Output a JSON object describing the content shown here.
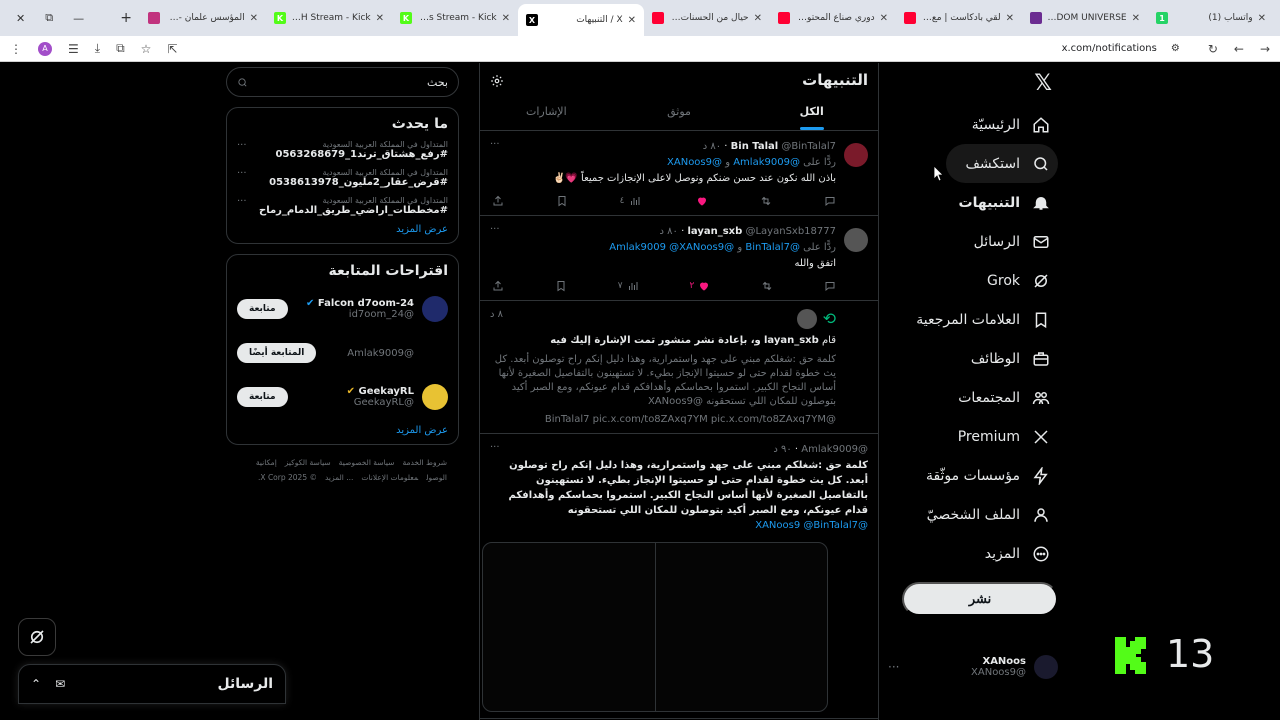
{
  "browser": {
    "tabs": [
      {
        "title": "واتساب (1)",
        "fav_color": "#25d366",
        "fav_text": "1"
      },
      {
        "title": "STARDOM UNIVERSE",
        "fav_color": "#6b2c91",
        "fav_text": ""
      },
      {
        "title": "لقي بادكاست | مع أبو...",
        "fav_color": "#ff0033",
        "fav_text": ""
      },
      {
        "title": "دوري صناع المحتوى -",
        "fav_color": "#ff0033",
        "fav_text": ""
      },
      {
        "title": "حيال من الحسنات يحدث...",
        "fav_color": "#ff0033",
        "fav_text": ""
      },
      {
        "title": "X / التنبيهات",
        "fav_color": "#000000",
        "fav_text": "X"
      },
      {
        "title": "XANoos Stream - Kick",
        "fav_color": "#53fc18",
        "fav_text": "K"
      },
      {
        "title": "OSAMAH Stream - Kick",
        "fav_color": "#53fc18",
        "fav_text": "K"
      },
      {
        "title": "المؤسس علمان -Play",
        "fav_color": "#c1337e",
        "fav_text": ""
      }
    ],
    "active_tab_index": 5,
    "url": "x.com/notifications",
    "profile_initial": "A"
  },
  "nav": {
    "items": [
      {
        "label": "الرئيسيّة",
        "icon": "home-icon",
        "key": "home"
      },
      {
        "label": "استكشف",
        "icon": "search-icon",
        "key": "explore"
      },
      {
        "label": "التنبيهات",
        "icon": "bell-icon",
        "key": "notifications"
      },
      {
        "label": "الرسائل",
        "icon": "mail-icon",
        "key": "messages"
      },
      {
        "label": "Grok",
        "icon": "grok-icon",
        "key": "grok"
      },
      {
        "label": "العلامات المرجعية",
        "icon": "bookmark-icon",
        "key": "bookmarks"
      },
      {
        "label": "الوظائف",
        "icon": "briefcase-icon",
        "key": "jobs"
      },
      {
        "label": "المجتمعات",
        "icon": "people-icon",
        "key": "communities"
      },
      {
        "label": "Premium",
        "icon": "x-logo-icon",
        "key": "premium"
      },
      {
        "label": "مؤسسات موثّقة",
        "icon": "lightning-icon",
        "key": "orgs"
      },
      {
        "label": "الملف الشخصيّ",
        "icon": "user-icon",
        "key": "profile"
      },
      {
        "label": "المزيد",
        "icon": "more-circle-icon",
        "key": "more"
      }
    ],
    "post_label": "نشر",
    "account": {
      "name": "XANoos",
      "handle": "@XANoos9"
    }
  },
  "center": {
    "title": "التنبيهات",
    "tabs": [
      "الكل",
      "موثق",
      "الإشارات"
    ],
    "notifications": [
      {
        "name": "Bin Talal",
        "handle": "@BinTalal7",
        "time": "٨٠ د",
        "reply_prefix": "ردًّا على",
        "reply_to_1": "@Amlak9009",
        "reply_and": "و",
        "reply_to_2": "@XANoos9",
        "text": "باذن الله نكون عند حسن ضنكم ونوصل لاعلى الإنجازات جميعاً 💗✌🏻",
        "likes": "",
        "views": "٤",
        "avatar_color": "#7a1a2a"
      },
      {
        "name": "layan_sxb",
        "handle": "@LayanSxb18777",
        "time": "٨٠ د",
        "reply_prefix": "ردًّا على",
        "reply_to_1": "@BinTalal7",
        "reply_and": "و",
        "reply_to_2": "@Amlak9009 @XANoos9",
        "text": "اتفق والله",
        "likes": "٢",
        "views": "٧",
        "avatar_color": "#555555"
      }
    ],
    "repost": {
      "time": "٨ د",
      "actor": "layan_sxb",
      "action_text": "و، بإعادة نشر منشور تمت الإشارة إليك فيه",
      "quoted": "كلمة حق :شغلكم مبني على جهد واستمرارية، وهذا دليل إنكم راح توصلون أبعد. كل يث خطوة لقدام حتى لو حسيتوا الإنجاز بطيء. لا تستهينون بالتفاصيل الصغيرة لأنها أساس النجاح الكبير. استمروا بحماسكم وأهدافكم قدام عيونكم، ومع الصبر أكيد بتوصلون للمكان اللي تستحقونه @XANoos9",
      "quoted_links": "@BinTalal7 pic.x.com/to8ZAxq7YM pic.x.com/to8ZAxq7YM"
    },
    "post": {
      "handle": "@Amlak9009",
      "time": "٩٠ د",
      "text": "كلمة حق :شغلكم مبني على جهد واستمرارية، وهذا دليل إنكم راح توصلون أبعد. كل يث خطوة لقدام حتى لو حسيتوا الإنجاز بطيء. لا تستهينون بالتفاصيل الصغيرة لأنها أساس النجاح الكبير. استمروا بحماسكم وأهدافكم قدام عيونكم، ومع الصبر أكيد بتوصلون للمكان اللي تستحقونه",
      "mentions": "@XANoos9 @BinTalal7"
    }
  },
  "side": {
    "search_placeholder": "بحث",
    "trends_title": "ما يحدث",
    "trends": [
      {
        "meta": "المتداول في المملكة العربية السعودية",
        "tag": "#رفع_هشتاق_ترند1_0563268679"
      },
      {
        "meta": "المتداول في المملكة العربية السعودية",
        "tag": "#قرض_عقار_2مليون_0538613978"
      },
      {
        "meta": "المتداول في المملكة العربية السعودية",
        "tag": "#مخططات_اراضي_طريق_الدمام_رماح"
      }
    ],
    "show_more": "عرض المزيد",
    "who_title": "اقتراحات المتابعة",
    "who": [
      {
        "name": "Falcon d7oom-24",
        "handle": "@id7oom_24",
        "button": "متابعة",
        "avatar_color": "#1f2a6b"
      },
      {
        "name": "",
        "handle": "@Amlak9009",
        "button": "المتابعة أيضًا",
        "avatar_color": "#000000"
      },
      {
        "name": "GeekayRL",
        "handle": "@GeekayRL",
        "button": "متابعة",
        "avatar_color": "#e8c233"
      }
    ],
    "footer": [
      "شروط الخدمة",
      "سياسة الخصوصية",
      "سياسة الكوكيز",
      "إمكانية الوصول",
      "معلومات الإعلانات",
      "... المزيد",
      "© 2025 X Corp."
    ]
  },
  "messages_drawer": {
    "title": "الرسائل"
  },
  "overlay": {
    "counter": "13",
    "kick_color": "#53fc18"
  }
}
